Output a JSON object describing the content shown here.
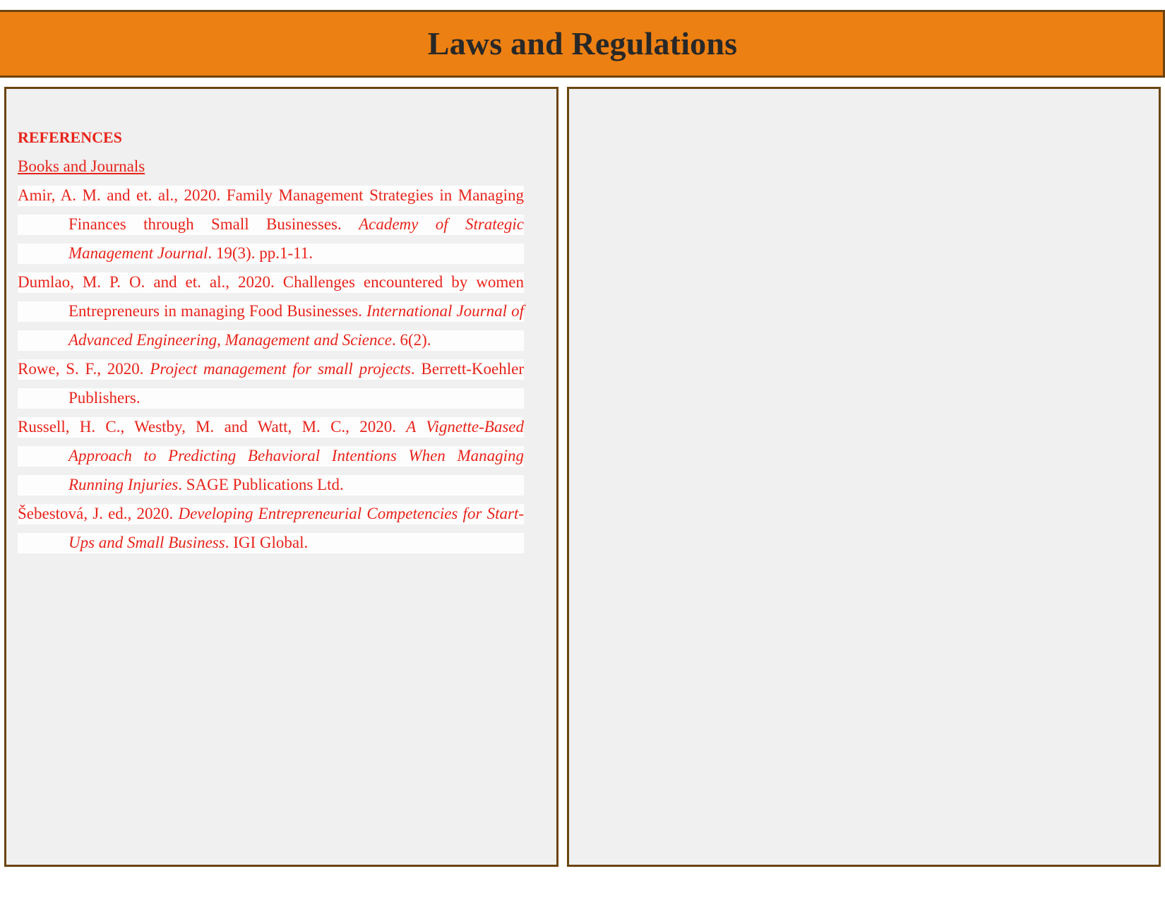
{
  "header": {
    "title": "Laws and Regulations",
    "background_color": "#ED8012",
    "border_color": "#6B4410",
    "title_color": "#282828"
  },
  "theme": {
    "panel_background": "#EFF0EF",
    "panel_border": "#6B4410",
    "reference_text_color": "#E8231A",
    "page_background": "#FFFFFF"
  },
  "left_panel": {
    "heading": "REFERENCES",
    "subheading": "Books and Journals",
    "references": [
      {
        "id": "amir-2020",
        "parts": [
          {
            "style": "normal",
            "text": "Amir, A. M. and et. al., 2020. Family Management Strategies in Managing Finances through Small Businesses. "
          },
          {
            "style": "italic",
            "text": "Academy of Strategic Management Journal"
          },
          {
            "style": "normal",
            "text": ". 19(3). pp.1-11."
          }
        ]
      },
      {
        "id": "dumlao-2020",
        "parts": [
          {
            "style": "normal",
            "text": "Dumlao, M. P. O. and et. al., 2020. Challenges encountered by women Entrepreneurs in managing Food Businesses. "
          },
          {
            "style": "italic",
            "text": "International Journal of Advanced Engineering, Management and Science"
          },
          {
            "style": "normal",
            "text": ". 6(2)."
          }
        ]
      },
      {
        "id": "rowe-2020",
        "parts": [
          {
            "style": "normal",
            "text": "Rowe, S. F., 2020. "
          },
          {
            "style": "italic",
            "text": "Project management for small projects"
          },
          {
            "style": "normal",
            "text": ". Berrett-Koehler Publishers."
          }
        ]
      },
      {
        "id": "russell-2020",
        "parts": [
          {
            "style": "normal",
            "text": "Russell, H. C., Westby, M. and Watt, M. C., 2020. "
          },
          {
            "style": "italic",
            "text": "A Vignette-Based Approach to Predicting Behavioral Intentions When Managing Running Injuries"
          },
          {
            "style": "normal",
            "text": ". SAGE Publications Ltd."
          }
        ]
      },
      {
        "id": "sebestova-2020",
        "parts": [
          {
            "style": "normal",
            "text": "Šebestová, J. ed., 2020. "
          },
          {
            "style": "italic",
            "text": "Developing Entrepreneurial Competencies for Start-Ups and Small Business"
          },
          {
            "style": "normal",
            "text": ". IGI Global."
          }
        ]
      }
    ]
  },
  "right_panel": {
    "content": "",
    "empty": true
  }
}
